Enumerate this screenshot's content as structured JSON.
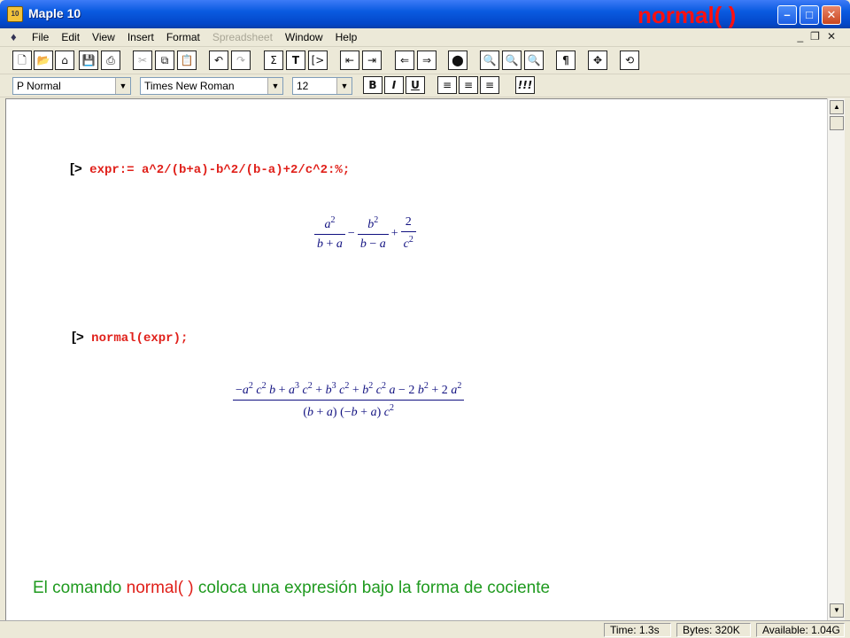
{
  "window": {
    "title": "Maple 10",
    "app_icon_text": "10",
    "slide_title": "normal( )"
  },
  "menu": {
    "items": [
      "File",
      "Edit",
      "View",
      "Insert",
      "Format",
      "Spreadsheet",
      "Window",
      "Help"
    ],
    "disabled_index": 5
  },
  "toolbar2": {
    "style": "P Normal",
    "font": "Times New Roman",
    "size": "12",
    "bold": "B",
    "italic": "I",
    "underline": "U",
    "exec": "!!!"
  },
  "doc": {
    "cmd1": "expr:= a^2/(b+a)-b^2/(b-a)+2/c^2:%;",
    "cmd2": "normal(expr);",
    "prompt_symbol": "[>",
    "caption_pre": "El comando ",
    "caption_cmd": "normal( )",
    "caption_post": " coloca una expresión bajo la forma de cociente"
  },
  "status": {
    "time": "Time:  1.3s",
    "bytes": "Bytes:  320K",
    "available": "Available:  1.04G"
  },
  "colors": {
    "input_red": "#e0201a",
    "output_blue": "#101080",
    "caption_green": "#1f9a1f",
    "title_red": "#ff1010"
  }
}
